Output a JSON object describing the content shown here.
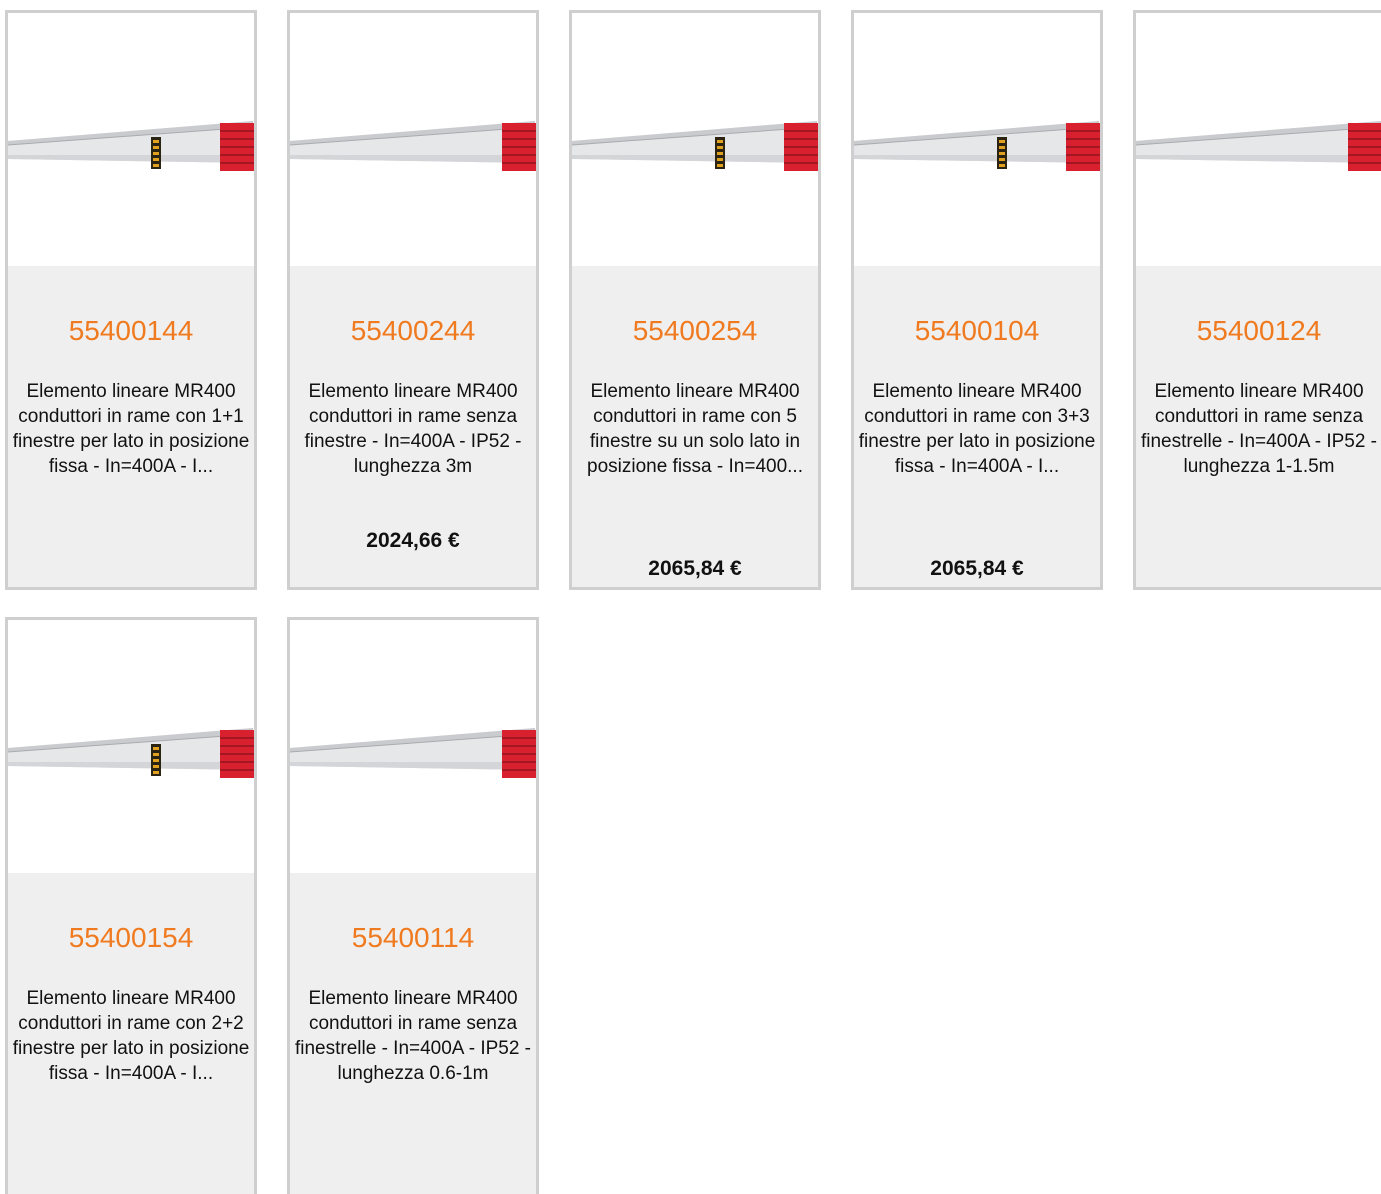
{
  "products": [
    {
      "code": "55400144",
      "description": "Elemento lineare MR400 conduttori in rame con 1+1 finestre per lato in posizione fissa - In=400A - I...",
      "price": "",
      "image_alt": "busbar-trunking-with-window"
    },
    {
      "code": "55400244",
      "description": "Elemento lineare MR400 conduttori in rame senza finestre - In=400A - IP52 - lunghezza 3m",
      "price": "2024,66 €",
      "image_alt": "busbar-trunking"
    },
    {
      "code": "55400254",
      "description": "Elemento lineare MR400 conduttori in rame con 5 finestre su un solo lato in posizione fissa - In=400...",
      "price": "2065,84 €",
      "image_alt": "busbar-trunking-with-window"
    },
    {
      "code": "55400104",
      "description": "Elemento lineare MR400 conduttori in rame con 3+3 finestre per lato in posizione fissa - In=400A - I...",
      "price": "2065,84 €",
      "image_alt": "busbar-trunking-with-window"
    },
    {
      "code": "55400124",
      "description": "Elemento lineare MR400 conduttori in rame senza finestrelle - In=400A - IP52 - lunghezza 1-1.5m",
      "price": "",
      "image_alt": "busbar-trunking"
    },
    {
      "code": "55400154",
      "description": "Elemento lineare MR400 conduttori in rame con 2+2 finestre per lato in posizione fissa - In=400A - I...",
      "price": "",
      "image_alt": "busbar-trunking-with-window"
    },
    {
      "code": "55400114",
      "description": "Elemento lineare MR400 conduttori in rame senza finestrelle - In=400A - IP52 - lunghezza 0.6-1m",
      "price": "",
      "image_alt": "busbar-trunking"
    }
  ],
  "colors": {
    "code": "#f07a1f",
    "info_background": "#efefef",
    "border": "#cfcfcf",
    "connector_red": "#d8202f"
  }
}
